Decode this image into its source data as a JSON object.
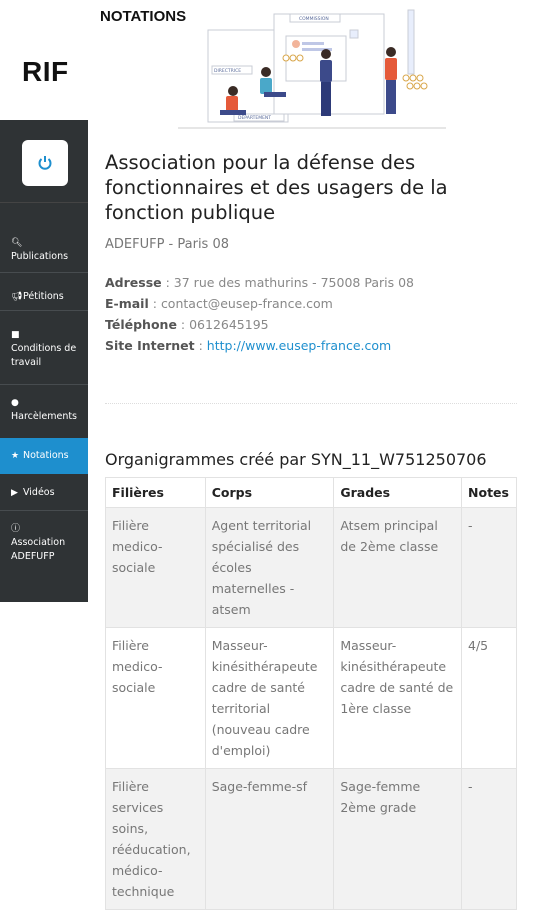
{
  "app": {
    "title": "RIF"
  },
  "page": {
    "heading": "NOTATIONS"
  },
  "hero": {
    "labels": [
      "COMMISSION",
      "DIRECTRICE",
      "DÉPARTEMENT"
    ]
  },
  "sidebar": {
    "items": [
      {
        "label": "Publications",
        "icon": "search-icon"
      },
      {
        "label": "Pétitions",
        "icon": "bullhorn-icon"
      },
      {
        "label": "Conditions de travail",
        "icon": "briefcase-icon"
      },
      {
        "label": "Harcèlements",
        "icon": "comment-icon"
      },
      {
        "label": "Notations",
        "icon": "star-icon",
        "active": true
      },
      {
        "label": "Vidéos",
        "icon": "video-icon"
      },
      {
        "label": "Association ADEFUFP",
        "icon": "info-icon"
      }
    ]
  },
  "org": {
    "name": "Association pour la défense des fonctionnaires et des usagers de la fonction publique",
    "short": "ADEFUFP - Paris 08",
    "address_label": "Adresse",
    "address": "37 rue des mathurins - 75008 Paris 08",
    "email_label": "E-mail",
    "email": "contact@eusep-france.com",
    "phone_label": "Téléphone",
    "phone": "0612645195",
    "site_label": "Site Internet",
    "site": "http://www.eusep-france.com"
  },
  "section": {
    "title": "Organigrammes créé par SYN_11_W751250706"
  },
  "table": {
    "headers": [
      "Filières",
      "Corps",
      "Grades",
      "Notes"
    ],
    "rows": [
      {
        "filiere": "Filière medico-sociale",
        "corps": "Agent territorial spécialisé des écoles maternelles - atsem",
        "grade": "Atsem principal de 2ème classe",
        "note": "-"
      },
      {
        "filiere": "Filière medico-sociale",
        "corps": "Masseur-kinésithérapeute cadre de santé territorial (nouveau cadre d'emploi)",
        "grade": "Masseur-kinésithérapeute cadre de santé de 1ère classe",
        "note": "4/5"
      },
      {
        "filiere": "Filière services soins, rééducation, médico-technique",
        "corps": "Sage-femme-sf",
        "grade": "Sage-femme 2ème grade",
        "note": "-"
      }
    ]
  },
  "colors": {
    "sidebar": "#2f3335",
    "accent": "#1e8fce"
  }
}
